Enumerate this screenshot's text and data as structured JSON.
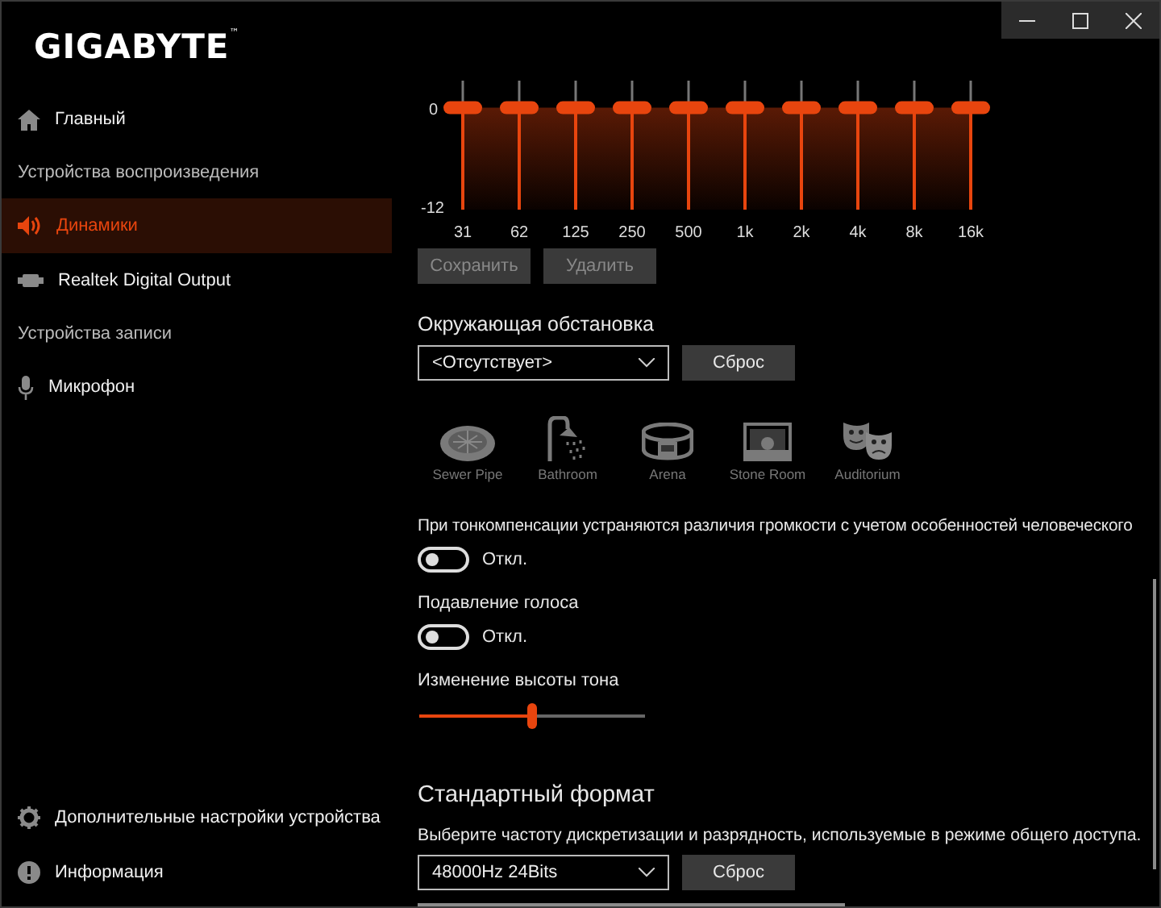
{
  "logo": "GIGABYTE$^{™}$",
  "sidebar": {
    "items": [
      {
        "kind": "item",
        "label": "Главный",
        "selected": false
      },
      {
        "kind": "heading",
        "label": "Устройства воспроизведения"
      },
      {
        "kind": "item",
        "label": "Динамики",
        "selected": true
      },
      {
        "kind": "item",
        "label": "Realtek Digital Output",
        "selected": false
      },
      {
        "kind": "heading",
        "label": "Устройства записи"
      },
      {
        "kind": "item",
        "label": "Микрофон",
        "selected": false
      }
    ],
    "footer": [
      {
        "label": "Дополнительные настройки устройства"
      },
      {
        "label": "Информация"
      }
    ]
  },
  "equalizer": {
    "scale": [
      "0",
      "-12"
    ],
    "bands": [
      {
        "label": "31",
        "level": 0.79
      },
      {
        "label": "62",
        "level": 0.79
      },
      {
        "label": "125",
        "level": 0.79
      },
      {
        "label": "250",
        "level": 0.79
      },
      {
        "label": "500",
        "level": 0.79
      },
      {
        "label": "1k",
        "level": 0.79
      },
      {
        "label": "2k",
        "level": 0.79
      },
      {
        "label": "4k",
        "level": 0.79
      },
      {
        "label": "8k",
        "level": 0.79
      },
      {
        "label": "16k",
        "level": 0.79
      }
    ],
    "buttons": [
      {
        "label": "Сохранить",
        "disabled": true
      },
      {
        "label": "Удалить",
        "disabled": true
      }
    ]
  },
  "environment": {
    "title": "Окружающая обстановка",
    "dropdown": "<Отсутствует>",
    "reset": "Сброс",
    "presets": [
      {
        "kind": "sewer",
        "label": "Sewer Pipe"
      },
      {
        "kind": "bathroom",
        "label": "Bathroom"
      },
      {
        "kind": "arena",
        "label": "Arena"
      },
      {
        "kind": "stone",
        "label": "Stone Room"
      },
      {
        "kind": "auditorium",
        "label": "Auditorium"
      }
    ]
  },
  "loudness": {
    "text": "При тонкомпенсации устраняются различия громкости с учетом особенностей человеческого",
    "on": false,
    "state": "Откл."
  },
  "voice": {
    "title": "Подавление голоса",
    "on": false,
    "state": "Откл."
  },
  "pitch": {
    "title": "Изменение высоты тона",
    "level": 0.5
  },
  "format": {
    "title": "Стандартный формат",
    "description": "Выберите частоту дискретизации и разрядность, используемые в режиме общего доступа.",
    "dropdown": "48000Hz 24Bits",
    "reset": "Сброс"
  }
}
